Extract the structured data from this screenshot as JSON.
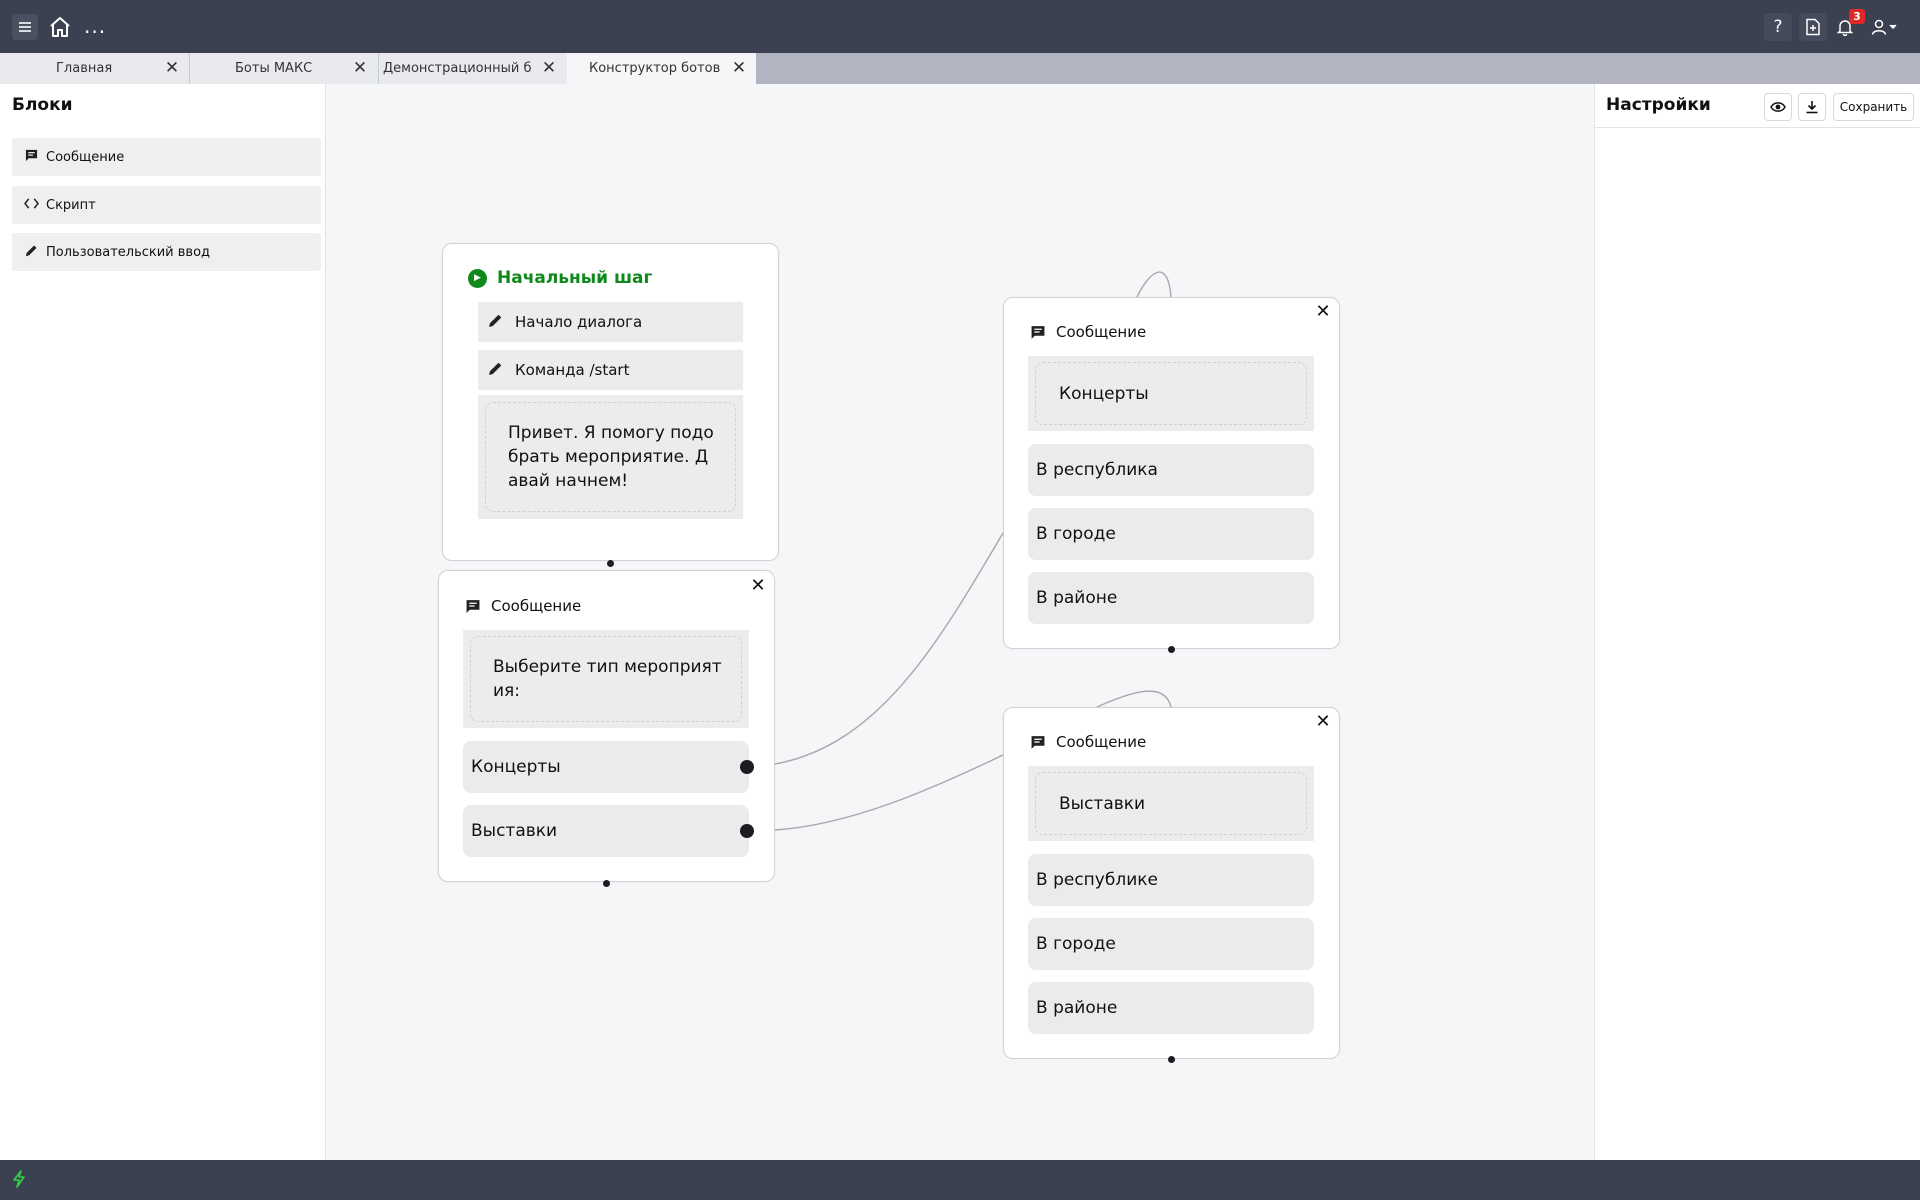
{
  "topbar": {
    "menu_icon": "hamburger-icon",
    "home_icon": "home-icon",
    "more_label": "...",
    "help_label": "?",
    "notifications_count": "3",
    "new_doc_icon": "document-plus-icon",
    "bell_icon": "bell-icon",
    "user_icon": "user-icon"
  },
  "tabs": [
    {
      "label": "Главная",
      "active": false
    },
    {
      "label": "Боты МАКС",
      "active": false
    },
    {
      "label": "Демонстрационный б...",
      "active": false
    },
    {
      "label": "Конструктор ботов",
      "active": true
    }
  ],
  "blocks_panel": {
    "title": "Блоки",
    "items": [
      {
        "label": "Сообщение",
        "icon": "message-icon"
      },
      {
        "label": "Скрипт",
        "icon": "code-icon"
      },
      {
        "label": "Пользовательский ввод",
        "icon": "pencil-icon"
      }
    ]
  },
  "settings_panel": {
    "title": "Настройки",
    "preview_icon": "eye-icon",
    "download_icon": "download-icon",
    "save_label": "Сохранить"
  },
  "canvas": {
    "start_node": {
      "title": "Начальный шаг",
      "triggers": [
        "Начало диалога",
        "Команда /start"
      ],
      "message": "Привет. Я помогу подобрать мероприятие. Давай начнем!",
      "message_lines": [
        "Привет. Я помогу подо",
        "брать мероприятие. Д",
        "авай начнем!"
      ]
    },
    "choice_node": {
      "type_label": "Сообщение",
      "message_lines": [
        "Выберите тип мероприят",
        "ия:"
      ],
      "buttons": [
        "Концерты",
        "Выставки"
      ]
    },
    "concerts_node": {
      "type_label": "Сообщение",
      "message": "Концерты",
      "buttons": [
        "В республика",
        "В городе",
        "В районе"
      ]
    },
    "exhibitions_node": {
      "type_label": "Сообщение",
      "message": "Выставки",
      "buttons": [
        "В республике",
        "В городе",
        "В районе"
      ]
    }
  },
  "colors": {
    "topbar_bg": "#3b4150",
    "start_green": "#0f8a1a",
    "badge_red": "#e02828",
    "status_green": "#33d14a"
  }
}
